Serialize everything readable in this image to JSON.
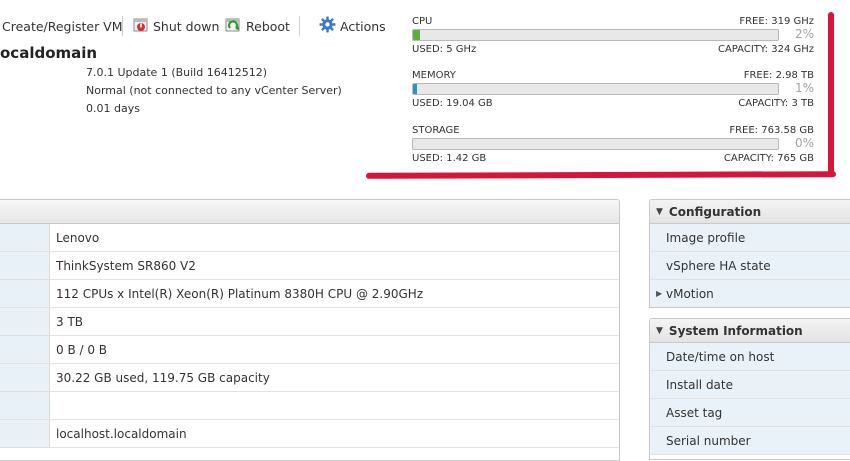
{
  "toolbar": {
    "create_label": "Create/Register VM",
    "shutdown_label": "Shut down",
    "reboot_label": "Reboot",
    "actions_label": "Actions"
  },
  "host": {
    "title": "ocaldomain",
    "version": "7.0.1 Update 1 (Build 16412512)",
    "state": "Normal (not connected to any vCenter Server)",
    "uptime": "0.01 days"
  },
  "resources": {
    "cpu": {
      "name": "CPU",
      "free": "FREE: 319 GHz",
      "percent_label": "2%",
      "percent": 2,
      "used": "USED: 5 GHz",
      "capacity": "CAPACITY: 324 GHz",
      "color": "#5aae3a"
    },
    "memory": {
      "name": "MEMORY",
      "free": "FREE: 2.98 TB",
      "percent_label": "1%",
      "percent": 1,
      "used": "USED: 19.04 GB",
      "capacity": "CAPACITY: 3 TB",
      "color": "#2e8fcf"
    },
    "storage": {
      "name": "STORAGE",
      "free": "FREE: 763.58 GB",
      "percent_label": "0%",
      "percent": 0,
      "used": "USED: 1.42 GB",
      "capacity": "CAPACITY: 765 GB",
      "color": "#2e8fcf"
    }
  },
  "hardware_rows": [
    {
      "value": "Lenovo"
    },
    {
      "value": "ThinkSystem SR860 V2"
    },
    {
      "value": "112 CPUs x Intel(R) Xeon(R) Platinum 8380H CPU @ 2.90GHz"
    },
    {
      "value": "3 TB"
    },
    {
      "value": "0 B / 0 B"
    },
    {
      "value": "30.22 GB used, 119.75 GB capacity"
    },
    {
      "value": ""
    },
    {
      "value": "localhost.localdomain"
    }
  ],
  "configuration": {
    "title": "Configuration",
    "items": [
      "Image profile",
      "vSphere HA state",
      "vMotion"
    ]
  },
  "system_information": {
    "title": "System Information",
    "items": [
      "Date/time on host",
      "Install date",
      "Asset tag",
      "Serial number"
    ]
  },
  "colors": {
    "annotation": "#d5153b",
    "accent": "#2e8fcf"
  }
}
